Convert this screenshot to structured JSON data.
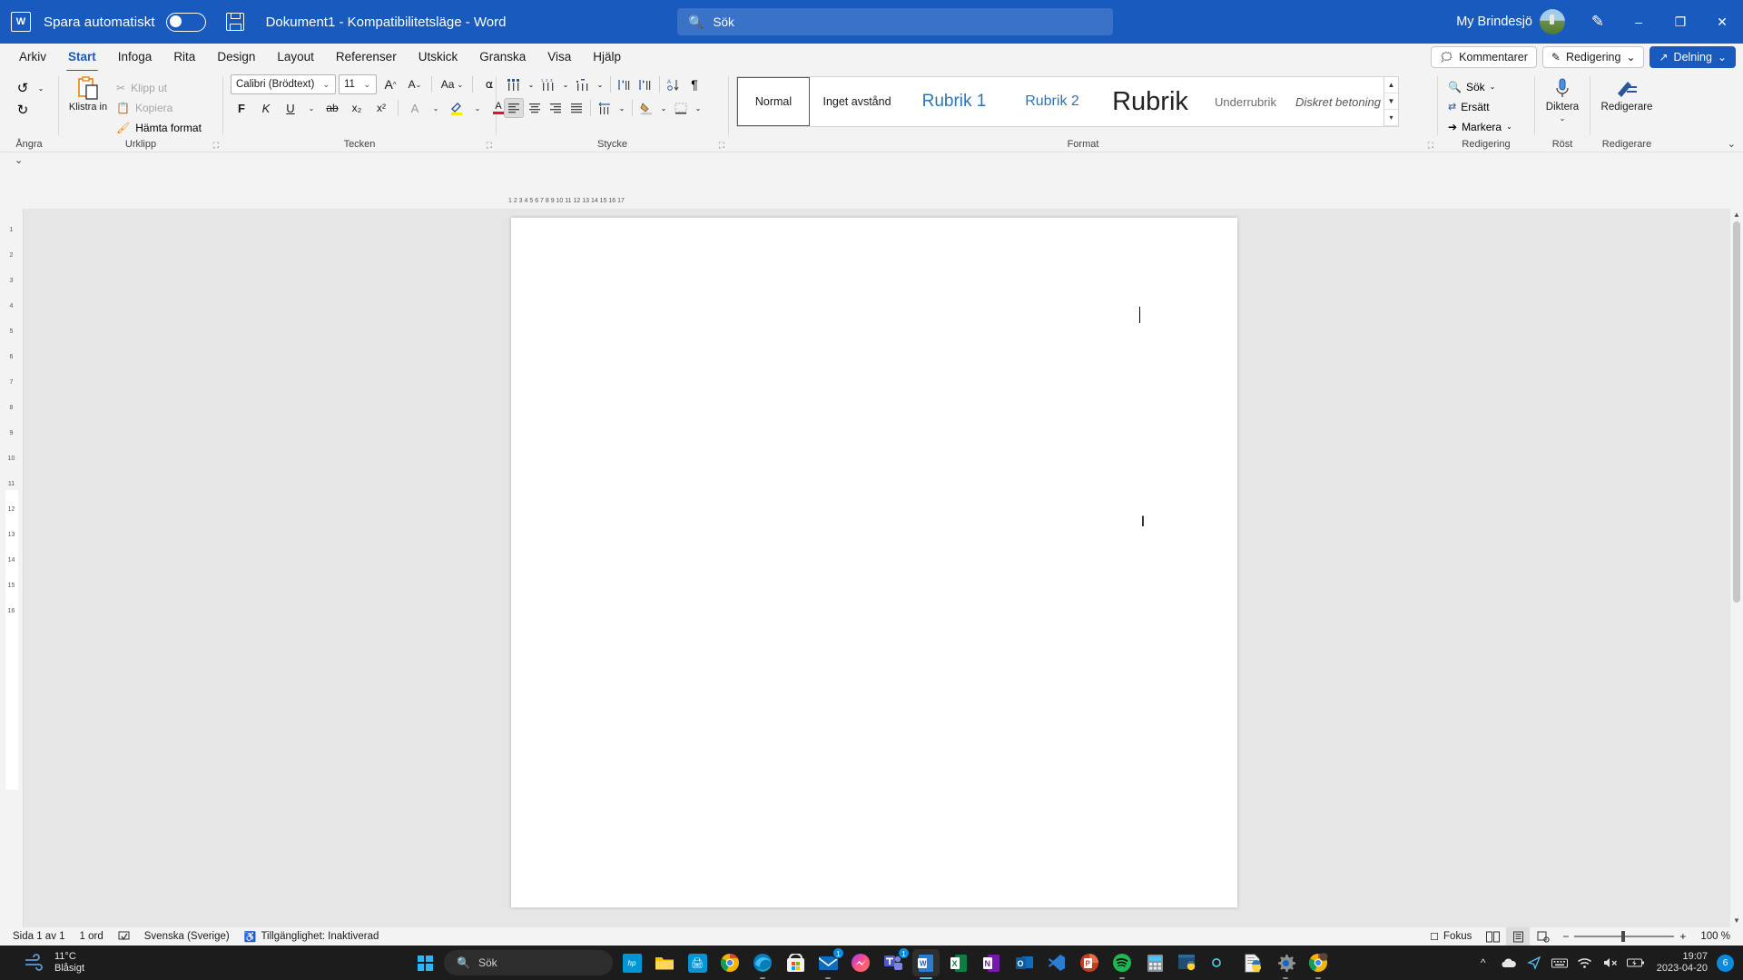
{
  "titlebar": {
    "app_icon": "word-icon",
    "autosave_label": "Spara automatiskt",
    "autosave_state": "off",
    "save_icon": "save-icon",
    "document_title": "Dokument1  -  Kompatibilitetsläge  -  Word",
    "search_placeholder": "Sök",
    "account_name": "My Brindesjö",
    "pen_icon": "pen-icon",
    "minimize": "–",
    "restore": "❐",
    "close": "✕",
    "bg_color": "#185abd"
  },
  "tabs": [
    {
      "label": "Arkiv",
      "active": false
    },
    {
      "label": "Start",
      "active": true
    },
    {
      "label": "Infoga",
      "active": false
    },
    {
      "label": "Rita",
      "active": false
    },
    {
      "label": "Design",
      "active": false
    },
    {
      "label": "Layout",
      "active": false
    },
    {
      "label": "Referenser",
      "active": false
    },
    {
      "label": "Utskick",
      "active": false
    },
    {
      "label": "Granska",
      "active": false
    },
    {
      "label": "Visa",
      "active": false
    },
    {
      "label": "Hjälp",
      "active": false
    }
  ],
  "tabrow_right": {
    "comments": "Kommentarer",
    "editing": "Redigering",
    "sharing": "Delning"
  },
  "ribbon": {
    "groups": {
      "undo": {
        "label": "Ångra",
        "undo_icon": "undo-icon",
        "redo_icon": "redo-icon"
      },
      "clipboard": {
        "label": "Urklipp",
        "paste": "Klistra in",
        "cut": "Klipp ut",
        "copy": "Kopiera",
        "format_painter": "Hämta format"
      },
      "font": {
        "label": "Tecken",
        "font_family": "Calibri (Brödtext)",
        "font_size": "11",
        "grow_font": "A",
        "shrink_font": "A",
        "change_case": "Aa",
        "clear_formatting": "clear-formatting-icon",
        "bold": "F",
        "italic": "K",
        "underline": "U",
        "strikethrough": "ab",
        "subscript": "x₂",
        "superscript": "x²",
        "text_effects": "A",
        "highlight": "highlight-icon",
        "font_color": "A"
      },
      "paragraph": {
        "label": "Stycke",
        "bullets": "bullets-icon",
        "numbering": "numbering-icon",
        "multilevel": "multilevel-list-icon",
        "decrease_indent": "decrease-indent-icon",
        "increase_indent": "increase-indent-icon",
        "sort": "sort-icon",
        "show_marks": "¶",
        "align_left": "align-left-icon",
        "align_center": "align-center-icon",
        "align_right": "align-right-icon",
        "justify": "justify-icon",
        "line_spacing": "line-spacing-icon",
        "shading": "shading-icon",
        "borders": "borders-icon"
      },
      "styles": {
        "label": "Format",
        "items": [
          {
            "name": "Normal",
            "selected": true
          },
          {
            "name": "Inget avstånd",
            "selected": false
          },
          {
            "name": "Rubrik 1",
            "selected": false
          },
          {
            "name": "Rubrik 2",
            "selected": false
          },
          {
            "name": "Rubrik",
            "selected": false
          },
          {
            "name": "Underrubrik",
            "selected": false
          },
          {
            "name": "Diskret betoning",
            "selected": false
          }
        ]
      },
      "editing": {
        "label": "Redigering",
        "find": "Sök",
        "replace": "Ersätt",
        "select": "Markera"
      },
      "voice": {
        "label": "Röst",
        "dictate": "Diktera"
      },
      "editor": {
        "label": "Redigerare",
        "editor": "Redigerare"
      }
    },
    "collapse_icon": "chevron-up-icon"
  },
  "document": {
    "ruler_numbers": "1   2   3   4   5   6   7   8   9   10   11   12   13   14   15   16   17",
    "vertical_ruler": [
      "1",
      "2",
      "3",
      "4",
      "5",
      "6",
      "7",
      "8",
      "9",
      "10",
      "11",
      "12",
      "13",
      "14",
      "15",
      "16"
    ],
    "page_content": "",
    "cursor_glyph": "I"
  },
  "statusbar": {
    "page": "Sida 1 av 1",
    "words": "1 ord",
    "proofing_icon": "proofing-icon",
    "language": "Svenska (Sverige)",
    "accessibility": "Tillgänglighet: Inaktiverad",
    "focus": "Fokus",
    "view_read": "read-mode-icon",
    "view_print": "print-layout-icon",
    "view_web": "web-layout-icon",
    "zoom_out": "−",
    "zoom_in": "+",
    "zoom_level": "100 %"
  },
  "taskbar": {
    "weather_temp": "11°C",
    "weather_desc": "Blåsigt",
    "start": "start-button",
    "search_placeholder": "Sök",
    "apps": [
      {
        "name": "myhp",
        "badge": ""
      },
      {
        "name": "file-explorer",
        "badge": ""
      },
      {
        "name": "hp-smart",
        "badge": ""
      },
      {
        "name": "chrome",
        "badge": ""
      },
      {
        "name": "edge",
        "badge": ""
      },
      {
        "name": "microsoft-store",
        "badge": ""
      },
      {
        "name": "mail",
        "badge": "1"
      },
      {
        "name": "messenger",
        "badge": ""
      },
      {
        "name": "teams",
        "badge": "1"
      },
      {
        "name": "word",
        "badge": ""
      },
      {
        "name": "excel",
        "badge": ""
      },
      {
        "name": "onenote",
        "badge": ""
      },
      {
        "name": "outlook",
        "badge": ""
      },
      {
        "name": "visual-studio",
        "badge": ""
      },
      {
        "name": "powerpoint",
        "badge": ""
      },
      {
        "name": "spotify",
        "badge": ""
      },
      {
        "name": "calculator",
        "badge": ""
      },
      {
        "name": "vscode-python",
        "badge": ""
      },
      {
        "name": "infinity-app",
        "badge": ""
      },
      {
        "name": "python-file",
        "badge": ""
      },
      {
        "name": "settings",
        "badge": ""
      },
      {
        "name": "chrome-profile",
        "badge": ""
      }
    ],
    "tray": {
      "overflow": "^",
      "onedrive": "onedrive-icon",
      "location": "location-icon",
      "keyboard": "keyboard-icon",
      "wifi": "wifi-icon",
      "volume": "volume-muted-icon",
      "battery": "battery-charging-icon",
      "time": "19:07",
      "date": "2023-04-20",
      "notifications": "6"
    }
  }
}
